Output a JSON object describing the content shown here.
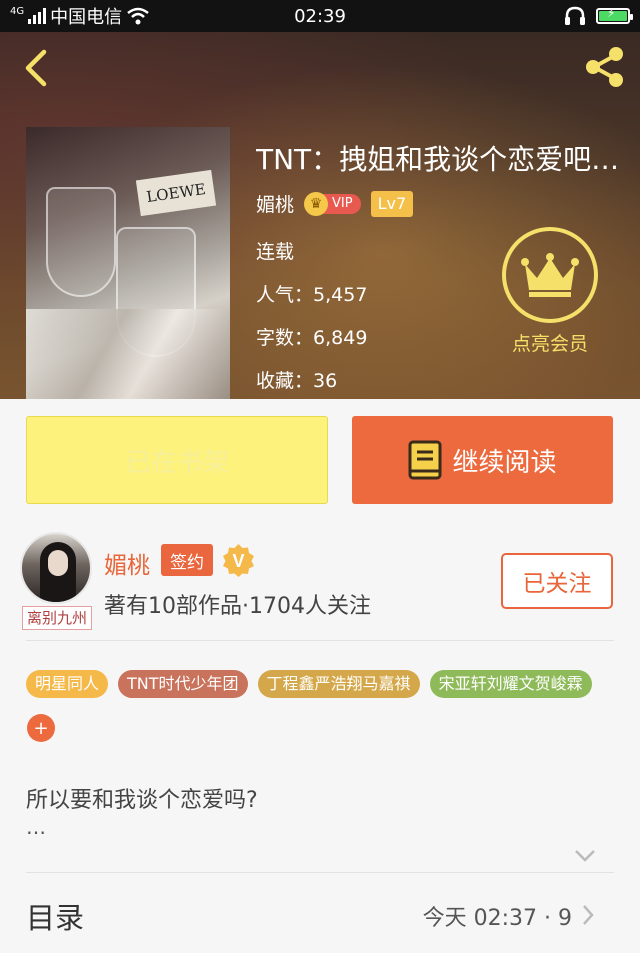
{
  "status_bar": {
    "carrier": "中国电信",
    "network": "4G",
    "time": "02:39"
  },
  "book": {
    "title": "TNT：拽姐和我谈个恋爱吧…",
    "author_name": "媚桃",
    "vip_label": "VIP",
    "level": "Lv7",
    "status": "连载",
    "popularity_label": "人气：",
    "popularity": "5,457",
    "word_count_label": "字数：",
    "word_count": "6,849",
    "favorites_label": "收藏：",
    "favorites": "36",
    "cover_brand_text": "LOEWE"
  },
  "vip_cta": {
    "label": "点亮会员"
  },
  "actions": {
    "shelf_label": "已在书架",
    "read_label": "继续阅读"
  },
  "author": {
    "name": "媚桃",
    "signed_badge": "签约",
    "avatar_tag": "离别九州",
    "stats": "著有10部作品·1704人关注",
    "follow_label": "已关注"
  },
  "tags": [
    {
      "label": "明星同人",
      "color": "#f5b94a"
    },
    {
      "label": "TNT时代少年团",
      "color": "#c9735c"
    },
    {
      "label": "丁程鑫严浩翔马嘉祺",
      "color": "#d4a84a"
    },
    {
      "label": "宋亚轩刘耀文贺峻霖",
      "color": "#8fba5a"
    }
  ],
  "tag_add_label": "+",
  "intro": {
    "text": "所以要和我谈个恋爱吗?",
    "ellipsis": "…"
  },
  "toc": {
    "label": "目录",
    "update": "今天 02:37 · 9"
  },
  "colors": {
    "accent": "#ec6a3e",
    "shelf_button": "#fcf27c",
    "vip_gold": "#f5e06a"
  }
}
